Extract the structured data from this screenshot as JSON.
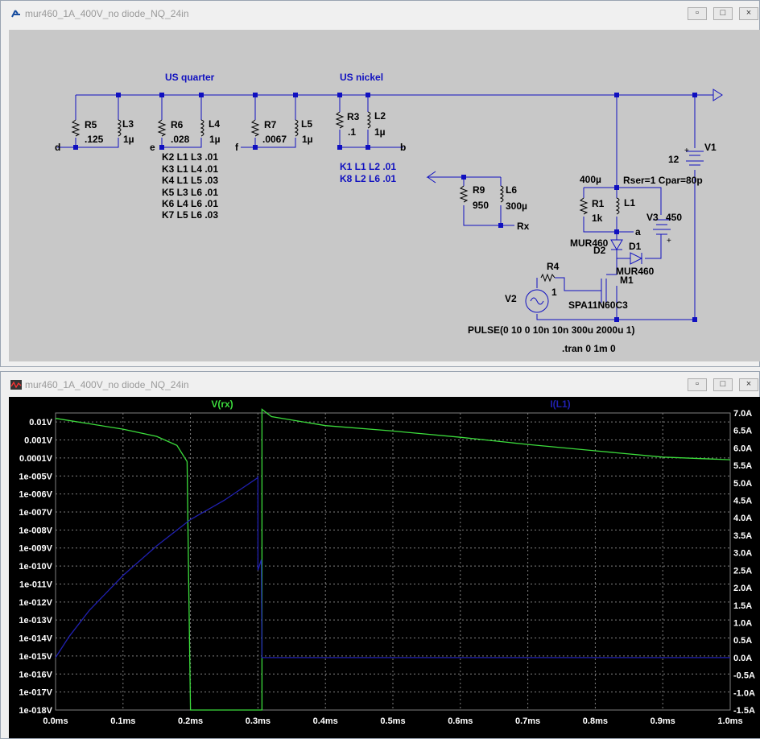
{
  "schematic_window": {
    "title": "mur460_1A_400V_no diode_NQ_24in",
    "buttons": [
      "minimize",
      "maximize",
      "close"
    ]
  },
  "plot_window": {
    "title": "mur460_1A_400V_no diode_NQ_24in",
    "buttons": [
      "minimize",
      "maximize",
      "close"
    ]
  },
  "schematic": {
    "labels": {
      "us_quarter": "US quarter",
      "us_nickel": "US nickel",
      "r5": "R5",
      "r5_val": ".125",
      "l3": "L3",
      "l3_val": "1µ",
      "r6": "R6",
      "r6_val": ".028",
      "l4": "L4",
      "l4_val": "1µ",
      "r7": "R7",
      "r7_val": ".0067",
      "l5": "L5",
      "l5_val": "1µ",
      "r3": "R3",
      "r3_val": ".1",
      "l2": "L2",
      "l2_val": "1µ",
      "node_d": "d",
      "node_e": "e",
      "node_f": "f",
      "node_b": "b",
      "node_a": "a",
      "node_rx": "Rx",
      "r9": "R9",
      "r9_val": "950",
      "l6": "L6",
      "l6_val": "300µ",
      "l1_val": "400µ",
      "r1": "R1",
      "r1_val": "1k",
      "l1": "L1",
      "rser": "Rser=1 Cpar=80p",
      "v1": "V1",
      "v1_val": "12",
      "v3": "V3",
      "v3_val": "450",
      "mur_d2": "MUR460",
      "d2": "D2",
      "d1": "D1",
      "mur_d1": "MUR460",
      "m1": "M1",
      "r4": "R4",
      "r4_val": "1",
      "v2": "V2",
      "m1_part": "SPA11N60C3",
      "pulse": "PULSE(0 10 0 10n 10n 300u 2000u 1)",
      "tran": ".tran 0 1m 0"
    },
    "k_lines_black": [
      "K2 L1 L3 .01",
      "K3 L1 L4 .01",
      "K4 L1 L5 .03",
      "K5 L3 L6 .01",
      "K6 L4 L6 .01",
      "K7 L5 L6 .03"
    ],
    "k_lines_blue": [
      "K1 L1 L2 .01",
      "K8 L2 L6 .01"
    ]
  },
  "chart_data": {
    "type": "line",
    "title": "",
    "series": [
      {
        "name": "V(rx)",
        "color": "#3cdc3c",
        "axis": "left",
        "points_log10": [
          [
            0.0,
            -1.8
          ],
          [
            0.05,
            -2.1
          ],
          [
            0.1,
            -2.4
          ],
          [
            0.15,
            -2.8
          ],
          [
            0.18,
            -3.3
          ],
          [
            0.195,
            -4.2
          ],
          [
            0.197,
            -10
          ],
          [
            0.2,
            -18
          ],
          [
            0.3,
            -18
          ],
          [
            0.306,
            -18
          ],
          [
            0.306,
            -1.3
          ],
          [
            0.32,
            -1.7
          ],
          [
            0.4,
            -2.2
          ],
          [
            0.5,
            -2.5
          ],
          [
            0.6,
            -2.85
          ],
          [
            0.7,
            -3.25
          ],
          [
            0.8,
            -3.6
          ],
          [
            0.9,
            -3.95
          ],
          [
            1.0,
            -4.1
          ]
        ]
      },
      {
        "name": "I(L1)",
        "color": "#2020b0",
        "axis": "right",
        "points": [
          [
            0.0,
            0.0
          ],
          [
            0.02,
            0.6
          ],
          [
            0.05,
            1.35
          ],
          [
            0.1,
            2.35
          ],
          [
            0.15,
            3.2
          ],
          [
            0.2,
            3.95
          ],
          [
            0.25,
            4.5
          ],
          [
            0.3,
            5.15
          ],
          [
            0.3,
            5.2
          ],
          [
            0.3,
            2.5
          ],
          [
            0.305,
            2.8
          ],
          [
            0.306,
            0.0
          ],
          [
            1.0,
            0.0
          ]
        ]
      }
    ],
    "x_ticks": [
      "0.0ms",
      "0.1ms",
      "0.2ms",
      "0.3ms",
      "0.4ms",
      "0.5ms",
      "0.6ms",
      "0.7ms",
      "0.8ms",
      "0.9ms",
      "1.0ms"
    ],
    "xlim": [
      0,
      1
    ],
    "left_ticks": [
      "0.01V",
      "0.001V",
      "0.0001V",
      "1e-005V",
      "1e-006V",
      "1e-007V",
      "1e-008V",
      "1e-009V",
      "1e-010V",
      "1e-011V",
      "1e-012V",
      "1e-013V",
      "1e-014V",
      "1e-015V",
      "1e-016V",
      "1e-017V",
      "1e-018V"
    ],
    "left_log_range": [
      -18,
      -1.5
    ],
    "right_ticks": [
      "7.0A",
      "6.5A",
      "6.0A",
      "5.5A",
      "5.0A",
      "4.5A",
      "4.0A",
      "3.5A",
      "3.0A",
      "2.5A",
      "2.0A",
      "1.5A",
      "1.0A",
      "0.5A",
      "0.0A",
      "-0.5A",
      "-1.0A",
      "-1.5A"
    ],
    "ylim_right": [
      -1.5,
      7.0
    ],
    "grid": true,
    "legend": "top"
  }
}
